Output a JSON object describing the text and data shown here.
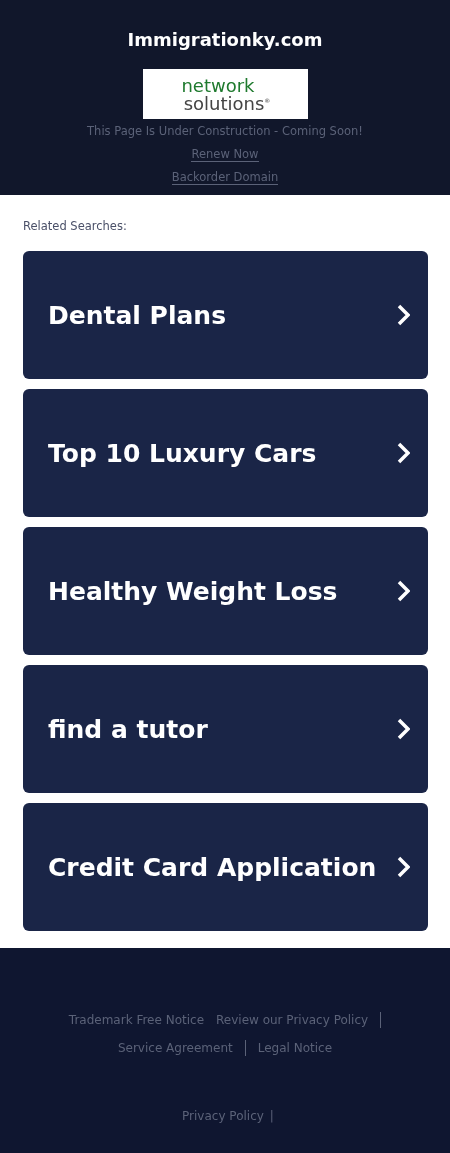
{
  "header": {
    "domain": "Immigrationky.com",
    "logo": {
      "line_1": "network",
      "line_2": "solutions",
      "mark": "®"
    },
    "notice": "This Page Is Under Construction - Coming Soon!",
    "links": [
      "Renew Now",
      "Backorder Domain"
    ]
  },
  "related": {
    "heading": "Related Searches:",
    "items": [
      {
        "label": "Dental Plans"
      },
      {
        "label": "Top 10 Luxury Cars"
      },
      {
        "label": "Healthy Weight Loss"
      },
      {
        "label": "find a tutor"
      },
      {
        "label": "Credit Card Application"
      }
    ]
  },
  "footer": {
    "links": [
      {
        "label": "Trademark Free Notice",
        "divider": false
      },
      {
        "label": "Review our Privacy Policy",
        "divider": true
      },
      {
        "label": "Service Agreement",
        "divider": true
      },
      {
        "label": "Legal Notice",
        "divider": false
      }
    ],
    "bottom_link": "Privacy Policy",
    "bottom_separator": "|"
  }
}
